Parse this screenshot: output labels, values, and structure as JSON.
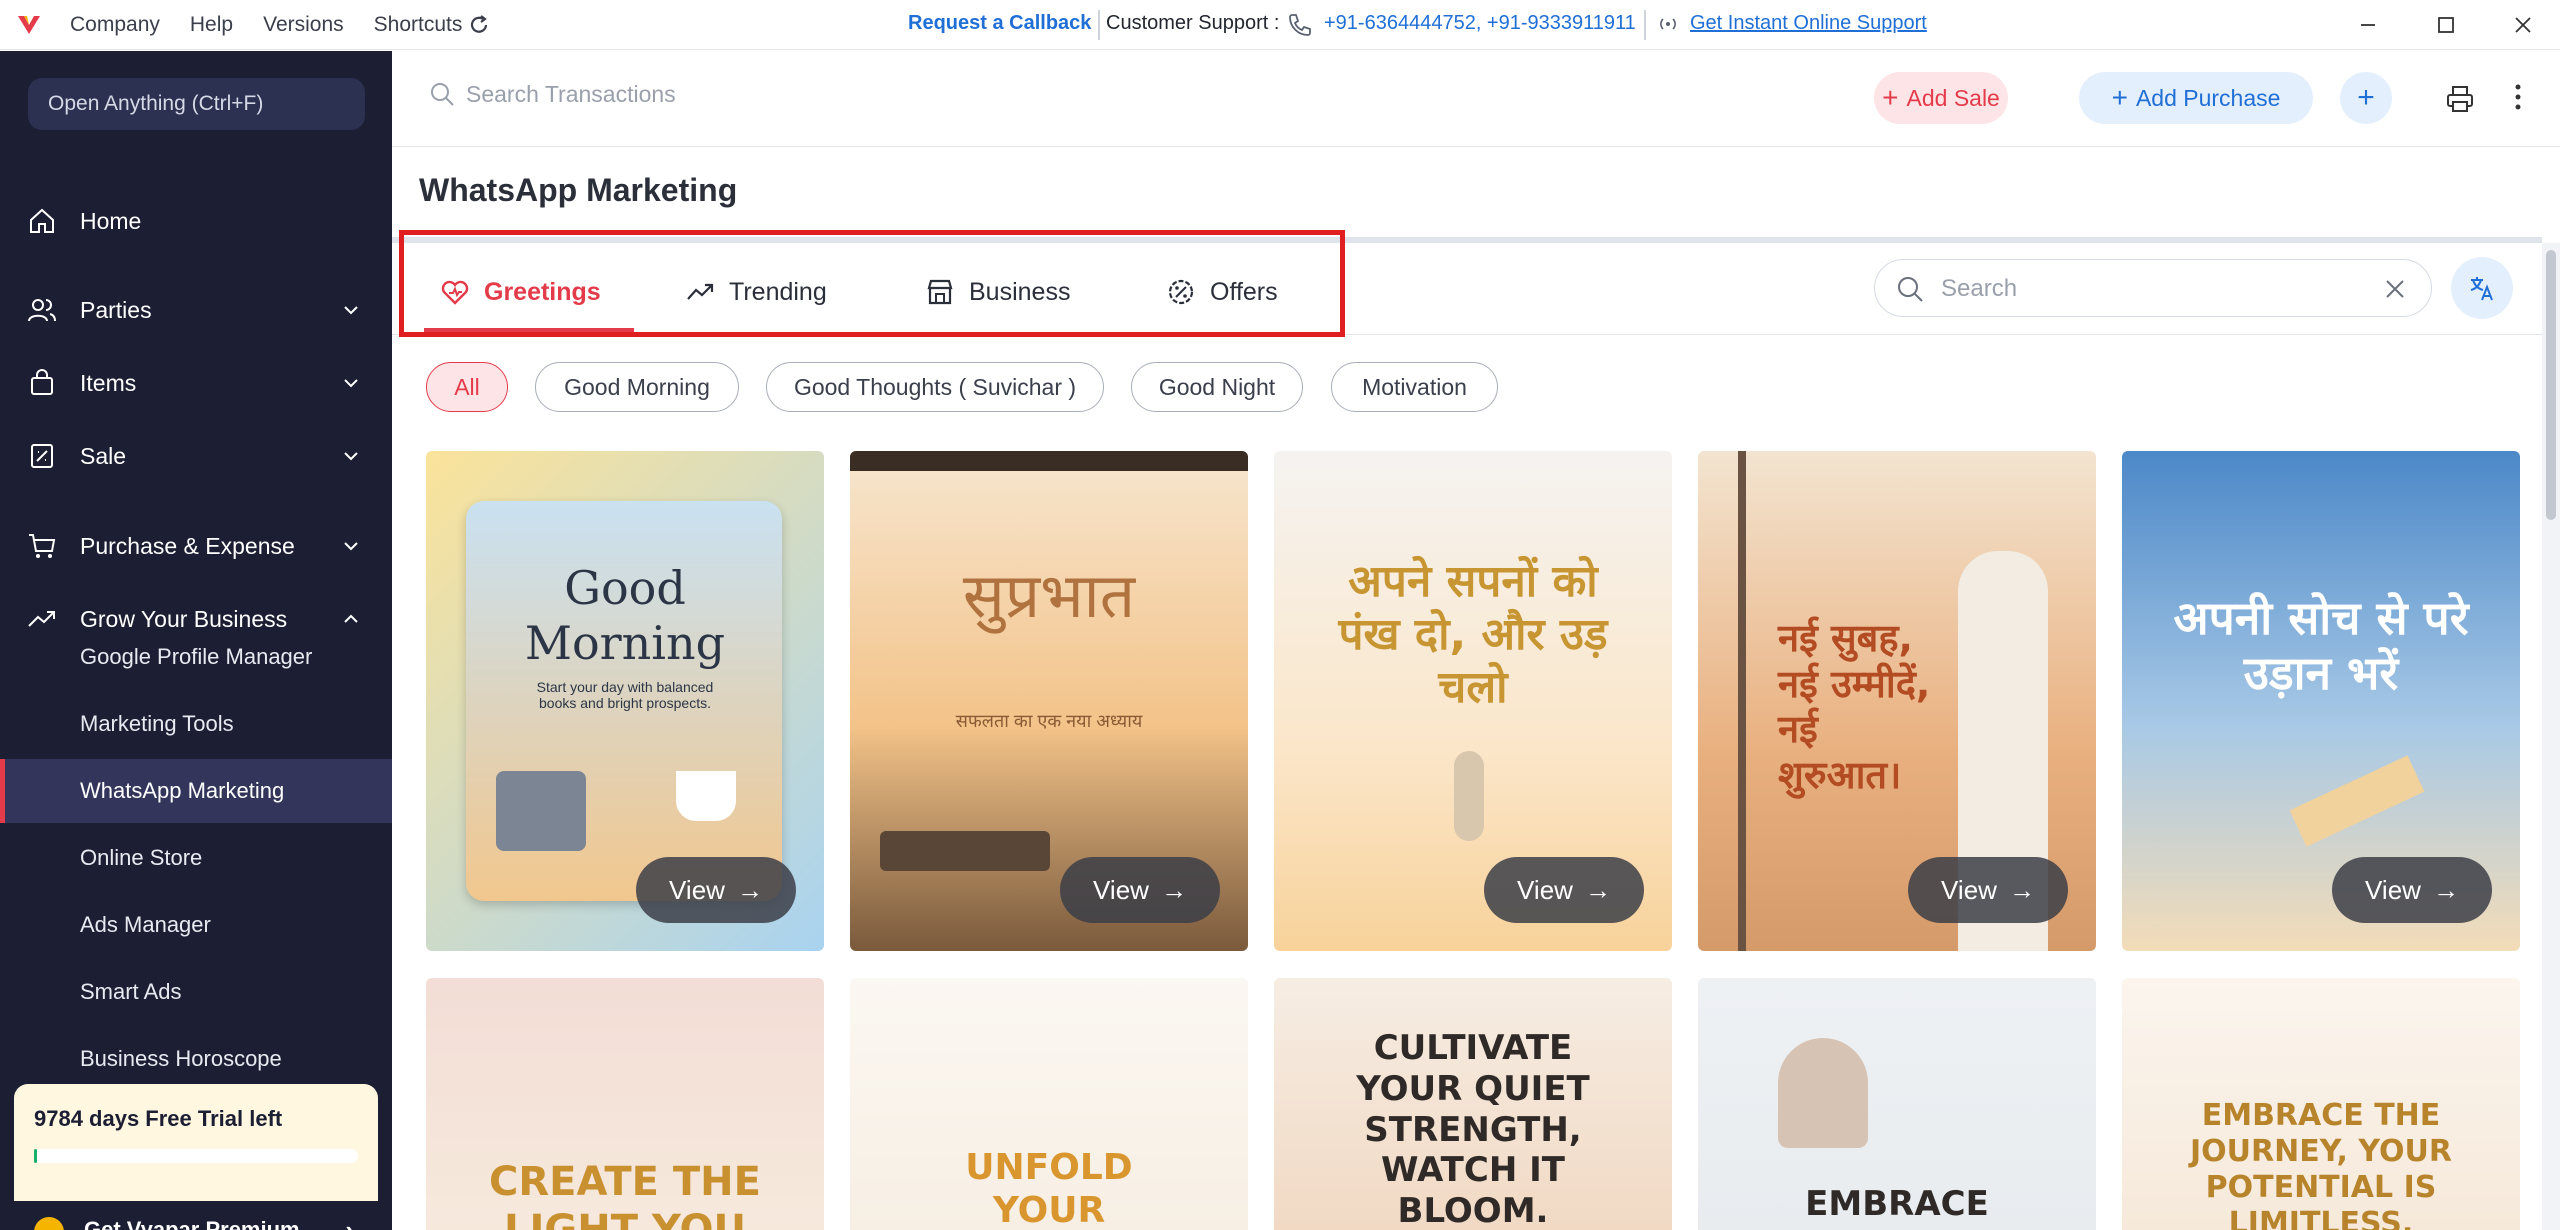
{
  "titlebar": {
    "menu": [
      "Company",
      "Help",
      "Versions",
      "Shortcuts"
    ],
    "callback": "Request a Callback",
    "support_label": "Customer Support :",
    "phones": "+91-6364444752, +91-9333911911",
    "instant_support": "Get Instant Online Support"
  },
  "sidebar": {
    "open_anything": "Open Anything (Ctrl+F)",
    "items": [
      {
        "label": "Home",
        "icon": "home-icon"
      },
      {
        "label": "Parties",
        "icon": "users-icon"
      },
      {
        "label": "Items",
        "icon": "bag-icon"
      },
      {
        "label": "Sale",
        "icon": "receipt-icon"
      },
      {
        "label": "Purchase & Expense",
        "icon": "cart-icon"
      },
      {
        "label": "Grow Your Business",
        "icon": "trending-icon"
      }
    ],
    "subitems": [
      "Google Profile Manager",
      "Marketing Tools",
      "WhatsApp Marketing",
      "Online Store",
      "Ads Manager",
      "Smart Ads",
      "Business Horoscope"
    ],
    "active_subitem": "WhatsApp Marketing",
    "trial_text": "9784 days Free Trial left",
    "trial_progress": 0.01,
    "premium_text": "Get Vyapar Premium"
  },
  "toolbar": {
    "search_placeholder": "Search Transactions",
    "add_sale": "Add Sale",
    "add_purchase": "Add Purchase"
  },
  "page": {
    "title": "WhatsApp Marketing",
    "tabs": [
      "Greetings",
      "Trending",
      "Business",
      "Offers"
    ],
    "active_tab": "Greetings",
    "search_placeholder": "Search",
    "chips": [
      "All",
      "Good Morning",
      "Good Thoughts ( Suvichar )",
      "Good Night",
      "Motivation"
    ],
    "active_chip": "All",
    "view_label": "View",
    "cards": [
      {
        "headline": "Good Morning",
        "sub": "Start your day with balanced books and bright prospects."
      },
      {
        "headline": "सुप्रभात",
        "sub": "सफलता का एक नया अध्याय"
      },
      {
        "headline": "अपने सपनों को पंख दो, और उड़ चलो",
        "sub": ""
      },
      {
        "headline": "नई सुबह, नई उम्मीदें, नई शुरुआत।",
        "sub": ""
      },
      {
        "headline": "अपनी सोच से परे उड़ान भरें",
        "sub": ""
      },
      {
        "headline": "CREATE THE LIGHT YOU",
        "sub": ""
      },
      {
        "headline": "UNFOLD YOUR POTENTIAL,",
        "sub": ""
      },
      {
        "headline": "CULTIVATE YOUR QUIET STRENGTH, WATCH IT BLOOM.",
        "sub": ""
      },
      {
        "headline": "EMBRACE GROWTH,",
        "sub": ""
      },
      {
        "headline": "EMBRACE THE JOURNEY, YOUR POTENTIAL IS LIMITLESS.",
        "sub": ""
      }
    ]
  },
  "colors": {
    "accent": "#e43b4b",
    "blue": "#1f6fd6",
    "sidebar": "#1c1e33"
  }
}
